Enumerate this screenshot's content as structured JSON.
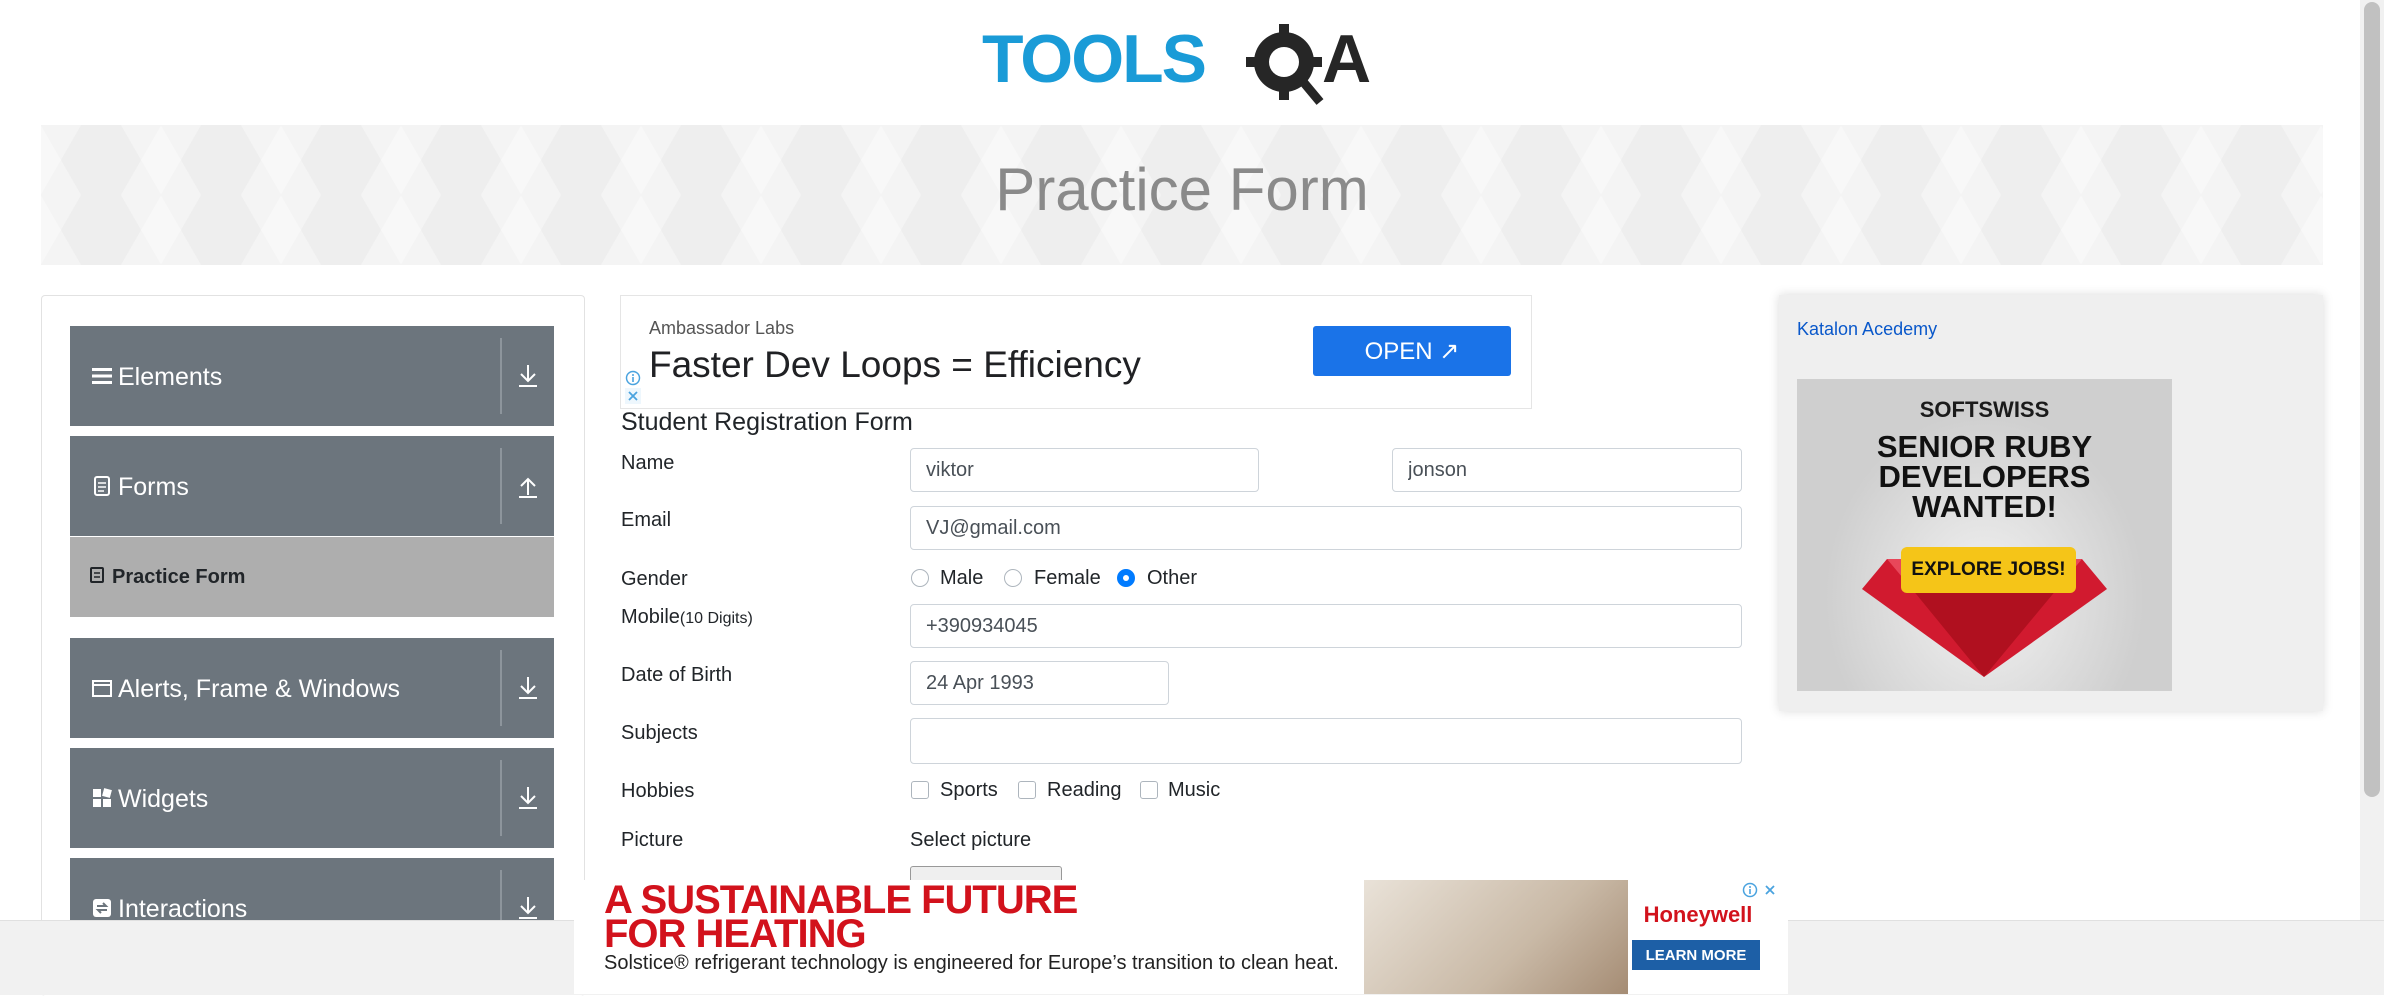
{
  "header": {
    "logo_text": "TOOLSQA",
    "page_title": "Practice Form"
  },
  "sidebar": {
    "groups": [
      {
        "label": "Elements",
        "icon": "list-icon",
        "expanded": false
      },
      {
        "label": "Forms",
        "icon": "document-icon",
        "expanded": true
      },
      {
        "label": "Alerts, Frame & Windows",
        "icon": "window-icon",
        "expanded": false
      },
      {
        "label": "Widgets",
        "icon": "widgets-icon",
        "expanded": false
      },
      {
        "label": "Interactions",
        "icon": "interactions-icon",
        "expanded": false
      }
    ],
    "active_item": "Practice Form"
  },
  "top_ad": {
    "source": "Ambassador Labs",
    "headline": "Faster Dev Loops = Efficiency",
    "button": "OPEN"
  },
  "form": {
    "title": "Student Registration Form",
    "name_label": "Name",
    "first_name": "viktor",
    "last_name": "jonson",
    "email_label": "Email",
    "email": "VJ@gmail.com",
    "gender_label": "Gender",
    "genders": [
      "Male",
      "Female",
      "Other"
    ],
    "gender_selected": "Other",
    "mobile_label": "Mobile",
    "mobile_hint": "(10 Digits)",
    "mobile": "+390934045",
    "dob_label": "Date of Birth",
    "dob": "24 Apr 1993",
    "subjects_label": "Subjects",
    "subjects": "",
    "hobbies_label": "Hobbies",
    "hobbies": [
      "Sports",
      "Reading",
      "Music"
    ],
    "picture_label": "Picture",
    "picture_text": "Select picture"
  },
  "right_ad": {
    "link_text": "Katalon Acedemy",
    "brand": "SOFTSWISS",
    "lines": [
      "SENIOR RUBY",
      "DEVELOPERS",
      "WANTED!"
    ],
    "button": "EXPLORE JOBS!"
  },
  "bottom_ad": {
    "line1": "A SUSTAINABLE FUTURE",
    "line2": "FOR HEATING",
    "sub": "Solstice® refrigerant technology is engineered for Europe’s transition to clean heat.",
    "brand": "Honeywell",
    "button": "LEARN MORE"
  },
  "colors": {
    "accent": "#007bff",
    "sidebar_group": "#6c757d",
    "ad_blue": "#1a73e8",
    "ad_red": "#d2121c"
  }
}
